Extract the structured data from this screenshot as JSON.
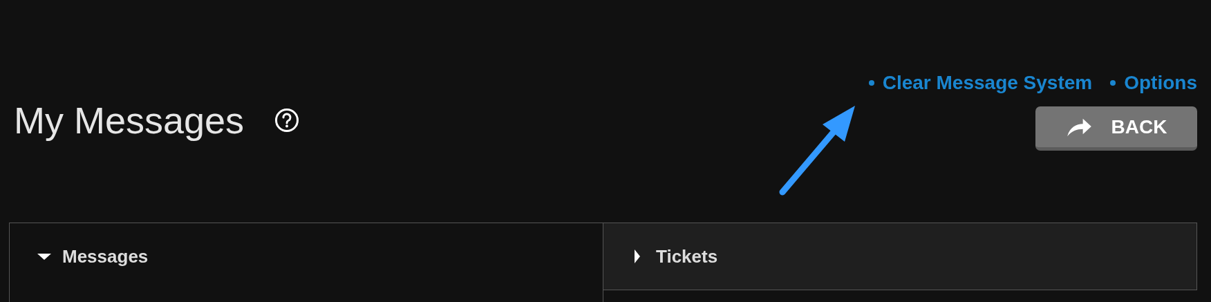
{
  "page": {
    "title": "My Messages"
  },
  "links": [
    "Clear Message System",
    "Options"
  ],
  "back_button": {
    "label": "BACK"
  },
  "tabs": [
    {
      "label": "Messages",
      "selected": true
    },
    {
      "label": "Tickets",
      "selected": false
    }
  ]
}
